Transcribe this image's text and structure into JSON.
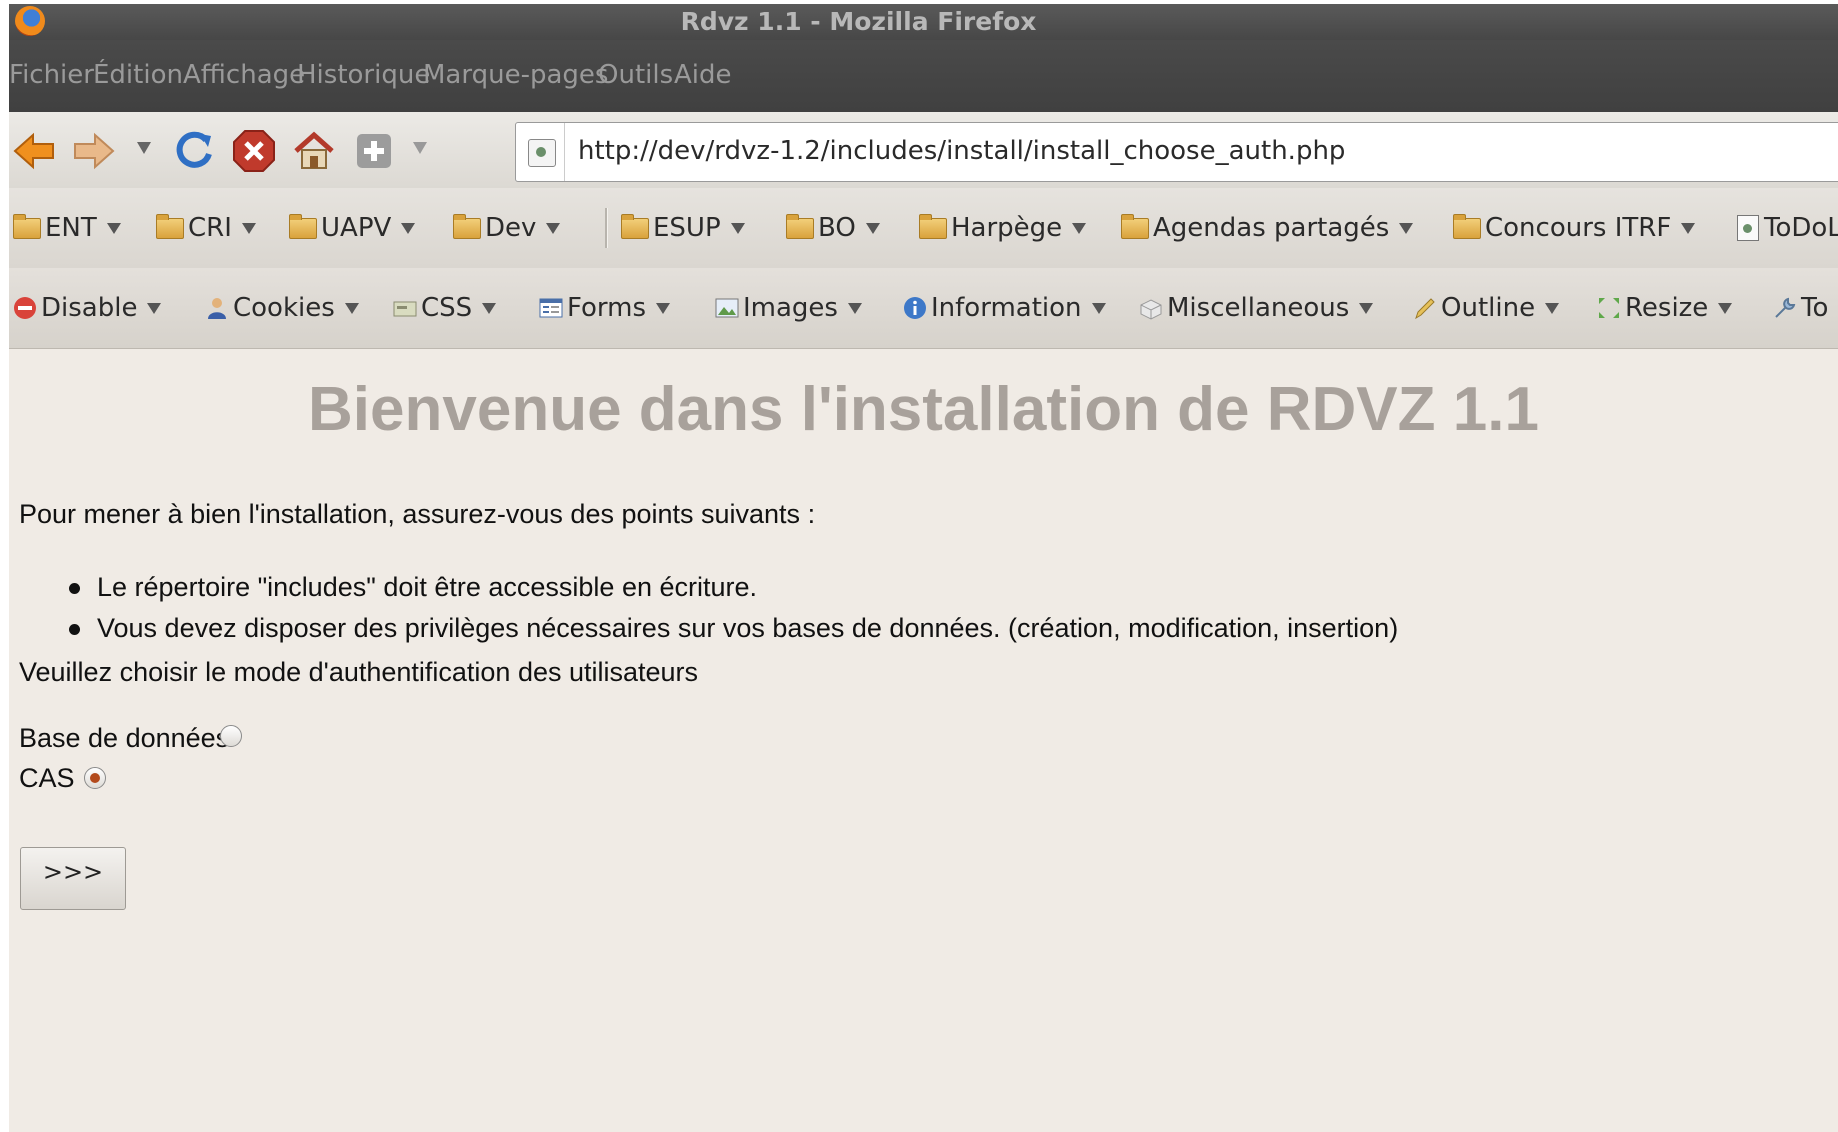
{
  "window": {
    "title": "Rdvz 1.1 - Mozilla Firefox"
  },
  "menubar": {
    "items": [
      "Fichier",
      "Édition",
      "Affichage",
      "Historique",
      "Marque-pages",
      "Outils",
      "Aide"
    ]
  },
  "navbar": {
    "url": "http://dev/rdvz-1.2/includes/install/install_choose_auth.php"
  },
  "bookmarks": {
    "items": [
      "ENT",
      "CRI",
      "UAPV",
      "Dev",
      "ESUP",
      "BO",
      "Harpège",
      "Agendas partagés",
      "Concours ITRF",
      "ToDoL"
    ]
  },
  "devtoolbar": {
    "items": [
      "Disable",
      "Cookies",
      "CSS",
      "Forms",
      "Images",
      "Information",
      "Miscellaneous",
      "Outline",
      "Resize",
      "To"
    ]
  },
  "page": {
    "title": "Bienvenue dans l'installation de RDVZ 1.1",
    "intro": "Pour mener à bien l'installation, assurez-vous des points suivants :",
    "requirements": [
      "Le répertoire \"includes\" doit être accessible en écriture.",
      "Vous devez disposer des privilèges nécessaires sur vos bases de données. (création, modification, insertion)"
    ],
    "choose_prompt": "Veuillez choisir le mode d'authentification des utilisateurs",
    "auth_options": [
      {
        "label": "Base de données",
        "selected": false
      },
      {
        "label": "CAS",
        "selected": true
      }
    ],
    "submit_label": ">>>"
  }
}
